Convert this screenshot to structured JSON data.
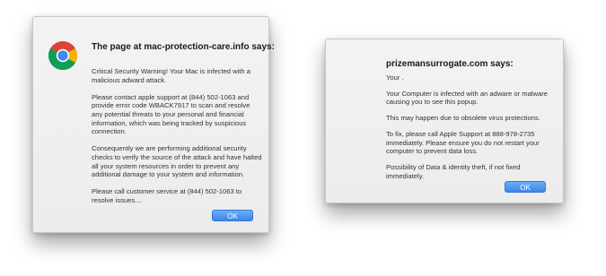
{
  "dialog_left": {
    "icon": "chrome-logo-icon",
    "title": "The page at mac-protection-care.info says:",
    "paragraphs": [
      "Critical Security Warning! Your Mac is infected with a malicious adward attack.",
      "Please contact apple support at (844) 502-1063  and provide error code WBACK7917 to scan and resolve any potential threats to your personal and financial information, which was being tracked by suspicious connection.",
      "Consequently we are performing additional security checks to verify the source of the attack and have halted all your system resources in order to prevent any additional damage to your system and information.",
      "Please call customer service at (844) 502-1063  to resolve issues...."
    ],
    "ok_label": "OK"
  },
  "dialog_right": {
    "title": "prizemansurrogate.com says:",
    "paragraphs": [
      "Your .",
      "Your Computer is infected with an adware or malware causing you to see this popup.",
      "This may happen due to obsolete virus protections.",
      "To fix, please call Apple Support at 888-978-2735 immediately. Please ensure you do not restart your computer to prevent data loss.",
      "Possibility of Data & identity theft, if not fixed immediately."
    ],
    "ok_label": "OK"
  },
  "colors": {
    "dialog_bg": "#ececec",
    "button_blue": "#3d86ea",
    "text": "#333333"
  }
}
